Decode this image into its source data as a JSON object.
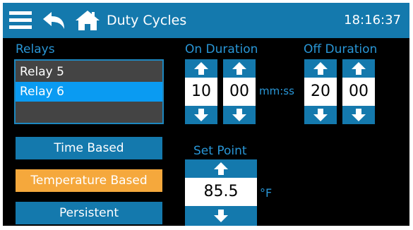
{
  "header": {
    "title": "Duty Cycles",
    "time": "18:16:37"
  },
  "relays": {
    "label": "Relays",
    "items": [
      {
        "label": "Relay 5",
        "selected": false
      },
      {
        "label": "Relay 6",
        "selected": true
      }
    ]
  },
  "modes": {
    "time_based": "Time Based",
    "temperature_based": "Temperature Based",
    "persistent": "Persistent",
    "active": "Temperature Based"
  },
  "on_duration": {
    "label": "On Duration",
    "minutes": "10",
    "seconds": "00"
  },
  "duration_unit": "mm:ss",
  "off_duration": {
    "label": "Off Duration",
    "minutes": "20",
    "seconds": "00"
  },
  "set_point": {
    "label": "Set Point",
    "value": "85.5",
    "unit": "°F"
  },
  "colors": {
    "header_bg": "#1479ad",
    "accent_text": "#2996d6",
    "selected_row": "#0a9bf2",
    "active_mode": "#f5a83c",
    "list_bg": "#444444"
  },
  "icons": [
    "menu-icon",
    "back-icon",
    "home-icon",
    "arrow-up-icon",
    "arrow-down-icon"
  ]
}
